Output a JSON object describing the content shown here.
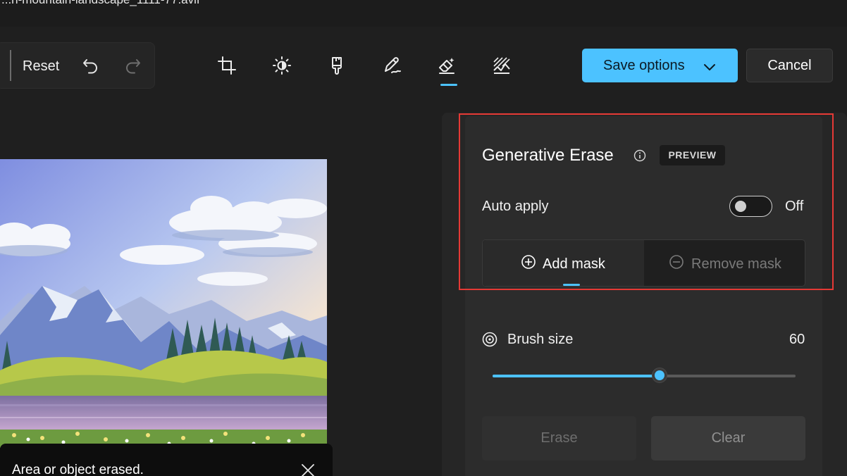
{
  "window": {
    "title": "...n-mountain-landscape_1111-77.avif"
  },
  "toolbar": {
    "reset_label": "Reset",
    "tools": [
      {
        "name": "crop-icon"
      },
      {
        "name": "adjust-brightness-icon"
      },
      {
        "name": "filter-brush-icon"
      },
      {
        "name": "markup-pen-icon"
      },
      {
        "name": "erase-icon"
      },
      {
        "name": "background-icon"
      }
    ],
    "active_tool": "erase-icon",
    "save_label": "Save options",
    "cancel_label": "Cancel"
  },
  "panel": {
    "title": "Generative Erase",
    "badge": "PREVIEW",
    "auto_apply_label": "Auto apply",
    "auto_apply_state": "Off",
    "add_mask_label": "Add mask",
    "remove_mask_label": "Remove mask",
    "brush_size_label": "Brush size",
    "brush_size_value": "60",
    "brush_fraction": 0.55,
    "erase_label": "Erase",
    "clear_label": "Clear"
  },
  "toast": {
    "message": "Area or object erased."
  },
  "colors": {
    "accent": "#4cc2ff",
    "highlight": "#e53935",
    "background": "#1f1f1f"
  }
}
